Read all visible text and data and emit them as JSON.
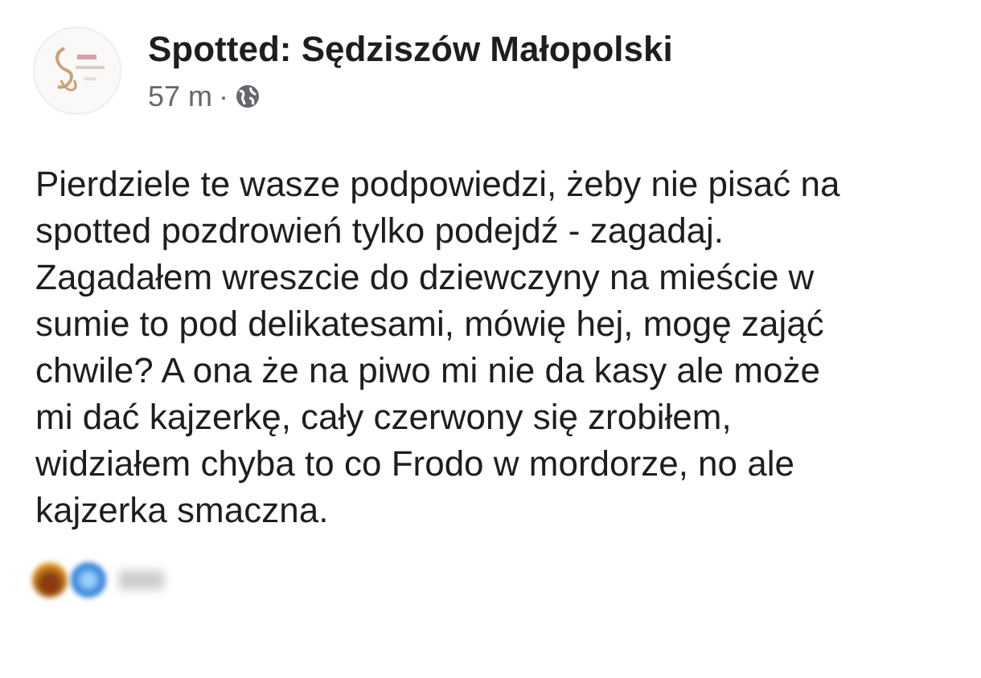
{
  "post": {
    "page_name": "Spotted: Sędziszów Małopolski",
    "time": "57 m",
    "separator": "·",
    "public": true,
    "text": "Pierdziele te wasze podpowiedzi, żeby nie pisać na\nspotted pozdrowień tylko podejdź - zagadaj.\nZagadałem wreszcie do dziewczyny na mieście w\nsumie to pod delikatesami, mówię hej, mogę zająć\nchwile? A ona że na piwo mi nie da kasy ale może\nmi dać kajzerkę, cały czerwony się zrobiłem,\nwidziałem chyba to co Frodo w mordorze, no ale\nkajzerka smaczna."
  },
  "reactions": [
    {
      "kind": "haha"
    },
    {
      "kind": "like"
    }
  ]
}
